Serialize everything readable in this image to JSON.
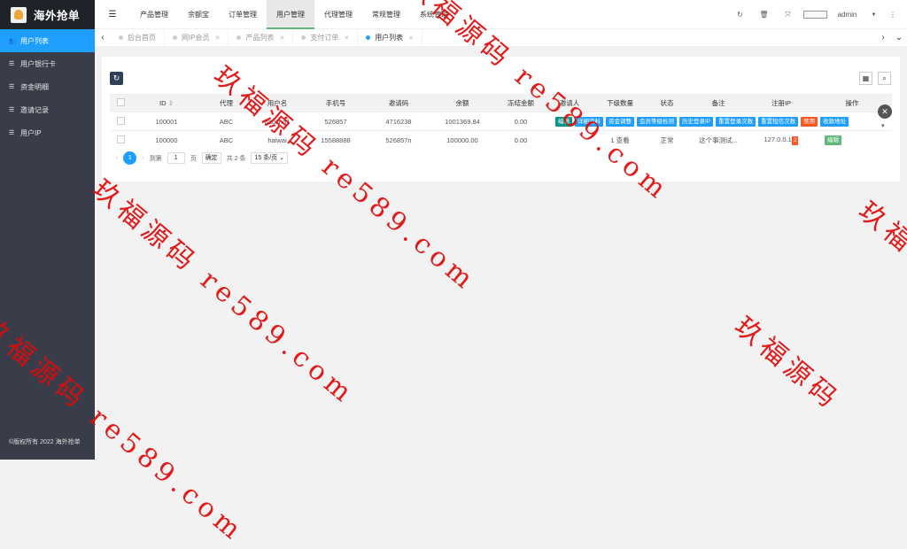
{
  "app": {
    "title": "海外抢单",
    "copyright": "©版权所有 2022 海外抢单"
  },
  "sidebar": {
    "items": [
      {
        "label": "用户列表",
        "icon": "user-icon",
        "active": true
      },
      {
        "label": "用户银行卡",
        "icon": "list-icon"
      },
      {
        "label": "资金明细",
        "icon": "list-icon"
      },
      {
        "label": "邀请记录",
        "icon": "list-icon"
      },
      {
        "label": "用户IP",
        "icon": "list-icon"
      }
    ]
  },
  "topnav": {
    "items": [
      "产品管理",
      "余额宝",
      "订单管理",
      "用户管理",
      "代理管理",
      "常规管理",
      "系统管理"
    ],
    "active": "用户管理",
    "user": "admin"
  },
  "tabs": {
    "items": [
      "后台首页",
      "网IP会员",
      "产品列表",
      "支付订单",
      "用户列表"
    ],
    "active": "用户列表"
  },
  "table": {
    "headers": [
      "ID",
      "代理",
      "用户名",
      "手机号",
      "邀请码",
      "余额",
      "冻结金额",
      "邀请人",
      "下级数量",
      "状态",
      "备注",
      "注册IP",
      "操作"
    ],
    "rows": [
      {
        "id": "100001",
        "agent": "ABC",
        "username": "gaoshd1",
        "phone": "526857",
        "invite_code": "4716238",
        "balance": "1001369.84",
        "frozen": "0.00",
        "inviter": "",
        "subs": "",
        "status": "",
        "remark": "",
        "ip": "",
        "ops": [
          "编辑",
          "详细资料",
          "资金调整",
          "会员等级检测",
          "历史登录IP",
          "重置登录次数",
          "重置短信次数",
          "禁用",
          "收款地址"
        ]
      },
      {
        "id": "100000",
        "agent": "ABC",
        "username": "haiwai",
        "phone": "15588888",
        "invite_code": "526857n",
        "balance": "100000.00",
        "frozen": "0.00",
        "inviter": "",
        "subs": "1 查看",
        "status": "正常",
        "remark": "这个事测试...",
        "ip": "127.0.0.1",
        "ip_badge": "2",
        "ops": [
          "编辑"
        ]
      }
    ]
  },
  "pager": {
    "current": "1",
    "goto_label": "到第",
    "page_value": "1",
    "page_unit": "页",
    "confirm": "确定",
    "total": "共 2 条",
    "per_page": "15 条/页"
  },
  "watermarks": [
    "玖福源码 re589.com",
    "玖福源码 re589.com",
    "玖福源码 re589.com",
    "玖福源码",
    "玖福源码 re589.com",
    "玖福"
  ]
}
